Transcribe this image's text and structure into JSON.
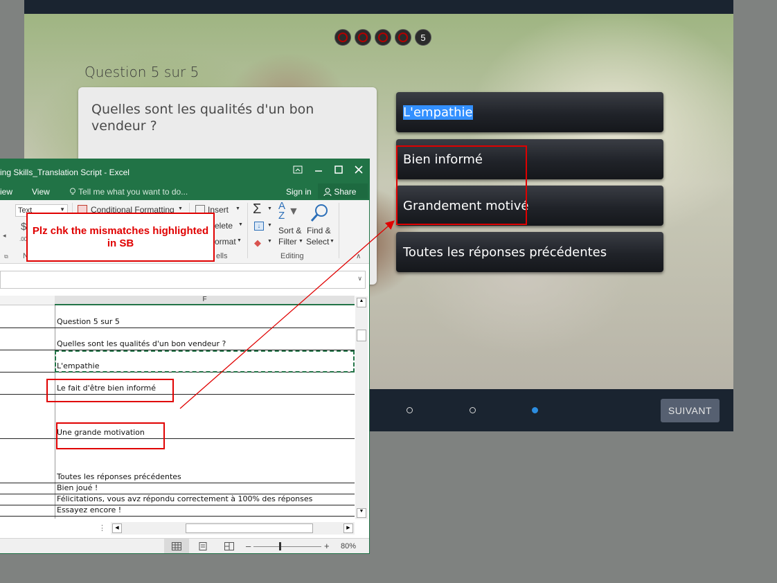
{
  "player": {
    "question_counter": "Question 5 sur 5",
    "progress_number": "5",
    "question": "Quelles sont les qualités d'un bon vendeur ?",
    "answers": [
      "L'empathie",
      "Bien informé",
      "Grandement motivé",
      "Toutes les réponses précédentes"
    ],
    "next_label": "SUIVANT"
  },
  "excel": {
    "title": "ing Skills_Translation Script - Excel",
    "menu": {
      "view_partial": "iew",
      "view": "View",
      "tell_me": "Tell me what you want to do...",
      "sign_in": "Sign in",
      "share": "Share"
    },
    "ribbon": {
      "number_format": "Text",
      "currency": "$",
      "conditional_formatting": "Conditional Formatting",
      "insert": "Insert",
      "delete": "elete",
      "format": "ormat",
      "cells_group": "ells",
      "sort_filter_1": "Sort &",
      "sort_filter_2": "Filter",
      "find_select_1": "Find &",
      "find_select_2": "Select",
      "editing_group": "Editing",
      "number_group_partial": "N"
    },
    "column_header": "F",
    "rows": [
      "Question 5 sur 5",
      "Quelles sont les qualités d'un bon vendeur ?",
      "L'empathie",
      "Le fait d'être bien informé",
      "Une grande motivation",
      "Toutes les réponses précédentes",
      "Bien joué !",
      "Félicitations, vous avz répondu correctement à 100% des réponses",
      "Essayez encore !"
    ],
    "zoom": "80%"
  },
  "annotation": {
    "callout": "Plz chk the mismatches highlighted in SB"
  },
  "colors": {
    "excel_green": "#217346",
    "annotation_red": "#e00000",
    "highlight_blue": "#3390ff"
  }
}
